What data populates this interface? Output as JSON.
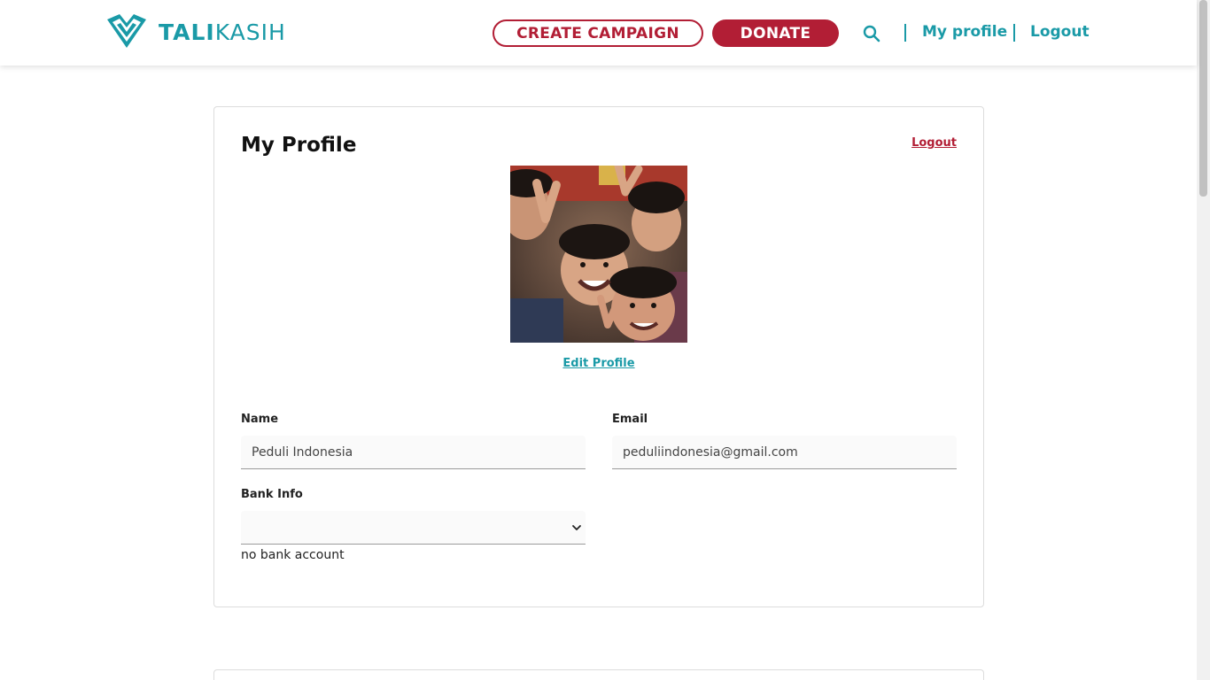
{
  "header": {
    "logo_text_bold": "TALI",
    "logo_text_light": "KASIH",
    "create_campaign_label": "CREATE CAMPAIGN",
    "donate_label": "DONATE",
    "search_icon": "search-icon",
    "my_profile_label": "My profile",
    "logout_label": "Logout"
  },
  "profile": {
    "title": "My Profile",
    "logout_link": "Logout",
    "avatar": "children-photo",
    "edit_profile_label": "Edit Profile",
    "name_label": "Name",
    "name_value": "Peduli Indonesia",
    "email_label": "Email",
    "email_value": "peduliindonesia@gmail.com",
    "bank_label": "Bank Info",
    "bank_value": "",
    "no_bank_text": "no bank account"
  },
  "colors": {
    "brand_teal": "#1a9aa7",
    "brand_red": "#b21e35"
  }
}
